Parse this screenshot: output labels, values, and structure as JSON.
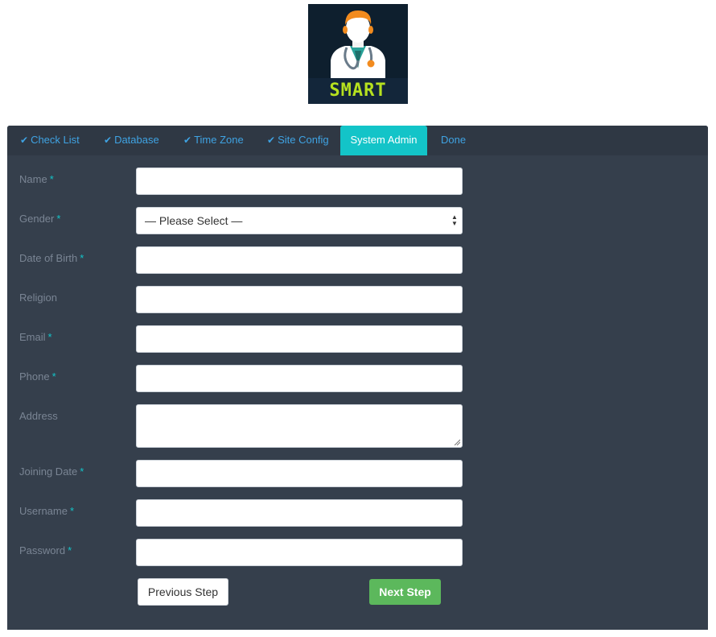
{
  "logo": {
    "text": "SMART"
  },
  "tabs": [
    {
      "label": "Check List",
      "done": true,
      "icon": "check-icon"
    },
    {
      "label": "Database",
      "done": true,
      "icon": "check-icon"
    },
    {
      "label": "Time Zone",
      "done": true,
      "icon": "check-icon"
    },
    {
      "label": "Site Config",
      "done": true,
      "icon": "check-icon"
    },
    {
      "label": "System Admin",
      "active": true
    },
    {
      "label": "Done"
    }
  ],
  "form": {
    "fields": [
      {
        "label": "Name",
        "required": "*",
        "value": ""
      },
      {
        "label": "Gender",
        "required": "*",
        "value": "— Please Select —"
      },
      {
        "label": "Date of Birth",
        "required": "*",
        "value": ""
      },
      {
        "label": "Religion",
        "value": ""
      },
      {
        "label": "Email",
        "required": "*",
        "value": ""
      },
      {
        "label": "Phone",
        "required": "*",
        "value": ""
      },
      {
        "label": "Address",
        "value": ""
      },
      {
        "label": "Joining Date",
        "required": "*",
        "value": ""
      },
      {
        "label": "Username",
        "required": "*",
        "value": ""
      },
      {
        "label": "Password",
        "required": "*",
        "value": ""
      }
    ],
    "prev_label": "Previous Step",
    "next_label": "Next Step"
  },
  "colors": {
    "accent": "#13c4c8",
    "link": "#3fa3e3",
    "panel": "#353f4c",
    "success": "#5cb85c"
  }
}
